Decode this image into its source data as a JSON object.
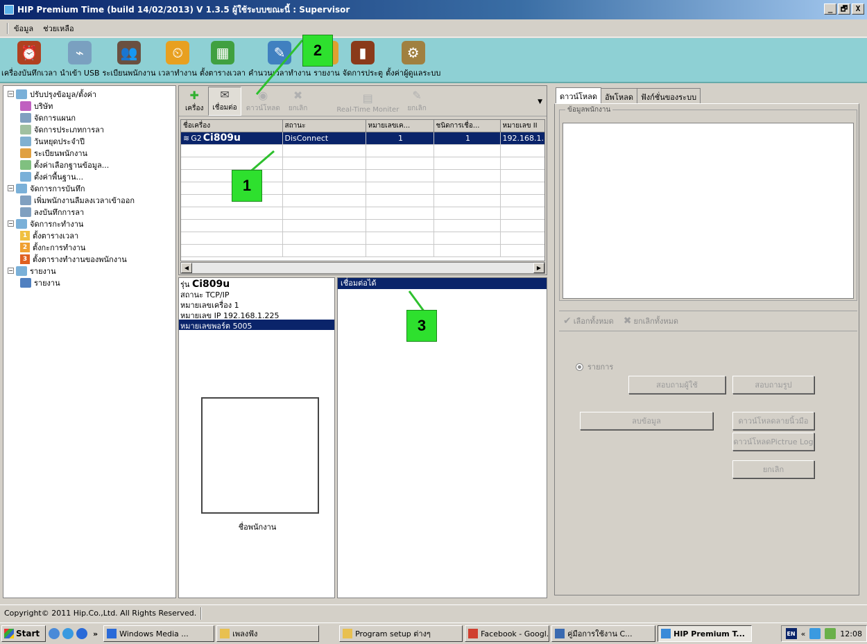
{
  "window": {
    "title": "HIP Premium Time (build 14/02/2013) V 1.3.5   ผู้ใช้ระบบขณะนี้ : Supervisor",
    "buttons": [
      "_",
      "🗗",
      "X"
    ]
  },
  "menu": [
    "ข้อมูล",
    "ช่วยเหลือ"
  ],
  "toolbar": [
    {
      "label": "เครื่องบันทึกเวลา",
      "icon": "clock-icon",
      "color": "#b04020"
    },
    {
      "label": "นำเข้า USB",
      "icon": "usb-icon",
      "color": "#7aa0c0"
    },
    {
      "label": "ระเบียนพนักงาน",
      "icon": "employees-icon",
      "color": "#6a5040"
    },
    {
      "label": "เวลาทำงาน",
      "icon": "alarm-icon",
      "color": "#e8a020"
    },
    {
      "label": "ตั้งตารางเวลา",
      "icon": "calendar-icon",
      "color": "#40a040"
    },
    {
      "label": "คำนวนเวลาทำงาน",
      "icon": "calculate-icon",
      "color": "#4080c0"
    },
    {
      "label": "รายงาน",
      "icon": "report-icon",
      "color": "#e0a030"
    },
    {
      "label": "จัดการประตู",
      "icon": "door-icon",
      "color": "#8a3a1a"
    },
    {
      "label": "ตั้งค่าผู้ดูแลระบบ",
      "icon": "admin-settings-icon",
      "color": "#a08040"
    }
  ],
  "tree": [
    {
      "level": 0,
      "label": "ปรับปรุงข้อมูล/ตั้งค่า",
      "expander": "−",
      "color": "#7ab0d8"
    },
    {
      "level": 1,
      "label": "บริษัท",
      "color": "#c060c0"
    },
    {
      "level": 1,
      "label": "จัดการแผนก",
      "color": "#80a0c0"
    },
    {
      "level": 1,
      "label": "จัดการประเภทการลา",
      "color": "#a0c0a0"
    },
    {
      "level": 1,
      "label": "วันหยุดประจำปี",
      "color": "#80b0d0"
    },
    {
      "level": 1,
      "label": "ระเบียนพนักงาน",
      "color": "#e0a040"
    },
    {
      "level": 1,
      "label": "ตั้งค่าเลือกฐานข้อมูล...",
      "color": "#80c080"
    },
    {
      "level": 1,
      "label": "ตั้งค่าพื้นฐาน...",
      "color": "#7ab0d8"
    },
    {
      "level": 0,
      "label": "จัดการการบันทึก",
      "expander": "−",
      "color": "#7ab0d8"
    },
    {
      "level": 1,
      "label": "เพิ่มพนักงานลืมลงเวลาเข้าออก",
      "color": "#80a0c0"
    },
    {
      "level": 1,
      "label": "ลงบันทึกการลา",
      "color": "#80a0c0"
    },
    {
      "level": 0,
      "label": "จัดการกะทำงาน",
      "expander": "−",
      "color": "#7ab0d8"
    },
    {
      "level": 1,
      "label": "ตั้งตารางเวลา",
      "num": "1",
      "color": "#f0c040"
    },
    {
      "level": 1,
      "label": "ตั้งกะการทำงาน",
      "num": "2",
      "color": "#f0a030"
    },
    {
      "level": 1,
      "label": "ตั้งตารางทำงานของพนักงาน",
      "num": "3",
      "color": "#e06020"
    },
    {
      "level": 0,
      "label": "รายงาน",
      "expander": "−",
      "color": "#7ab0d8"
    },
    {
      "level": 1,
      "label": "รายงาน",
      "color": "#5080c0"
    }
  ],
  "device_toolbar": [
    {
      "label": "เครื่อง",
      "icon": "plus-icon",
      "glyph": "✚",
      "enabled": true,
      "pressed": false
    },
    {
      "label": "เชื่อมต่อ",
      "icon": "connect-icon",
      "glyph": "✉",
      "enabled": true,
      "pressed": true
    },
    {
      "label": "ดาวน์โหลด",
      "icon": "download-icon",
      "glyph": "◉",
      "enabled": false,
      "pressed": false
    },
    {
      "label": "ยกเลิก",
      "icon": "cancel-icon",
      "glyph": "✖",
      "enabled": false,
      "pressed": false
    },
    {
      "label": "Real-Time Moniter",
      "icon": "monitor-icon",
      "glyph": "▤",
      "enabled": false,
      "pressed": false
    },
    {
      "label": "ยกเลิก",
      "icon": "cancel-monitor-icon",
      "glyph": "✎",
      "enabled": false,
      "pressed": false
    }
  ],
  "device_table": {
    "columns": [
      "ชื่อเครื่อง",
      "สถานะ",
      "หมายเลขเค...",
      "ชนิดการเชื่อ...",
      "หมายเลข II"
    ],
    "rows": [
      {
        "name_prefix": "G2",
        "name": "Ci809u",
        "status": "DisConnect",
        "machine_no": "1",
        "conn_type": "1",
        "ip": "192.168.1."
      }
    ]
  },
  "device_info": {
    "model_label": "รุ่น",
    "model": "Ci809u",
    "rows": [
      {
        "label": "สถานะ",
        "value": "TCP/IP"
      },
      {
        "label": "หมายเลขเครื่อง",
        "value": "1"
      },
      {
        "label": "หมายเลข IP",
        "value": "192.168.1.225"
      },
      {
        "label": "หมายเลขพอร์ต",
        "value": "5005"
      }
    ],
    "photo_label": "ชื่อพนักงาน"
  },
  "log": {
    "header": "เชื่อมต่อได้"
  },
  "right_panel": {
    "tabs": [
      "ดาวน์โหลด",
      "อัพโหลด",
      "ฟังก์ชั่นของระบบ"
    ],
    "group_label": "ข้อมูลพนักงาน",
    "select_all": "เลือกทั้งหมด",
    "deselect_all": "ยกเลิกทั้งหมด",
    "radio_label": "รายการ",
    "buttons": {
      "query_user": "สอบถามผู้ใช้",
      "query_photo": "สอบถามรูป",
      "delete_data": "ลบข้อมูล",
      "download_fingerprint": "ดาวน์โหลดลายนิ้วมือ",
      "download_picture_log": "ดาวน์โหลดPictrue Log",
      "cancel": "ยกเลิก"
    }
  },
  "status": {
    "copyright": "Copyright© 2011 Hip.Co.,Ltd. All Rights Reserved."
  },
  "taskbar": {
    "start": "Start",
    "chevron": "»",
    "items": [
      {
        "label": "Windows Media ...",
        "color": "#2a6ad8"
      },
      {
        "label": "เพลงฟัง",
        "color": "#e8c050"
      },
      {
        "label": "Program setup ต่างๆ",
        "color": "#e8c050"
      },
      {
        "label": "Facebook - Googl...",
        "color": "#d04030"
      },
      {
        "label": "คู่มือการใช้งาน C...",
        "color": "#3a6ab0"
      },
      {
        "label": "HIP Premium T...",
        "color": "#3a8ad8",
        "active": true
      }
    ],
    "lang": "EN",
    "tray_chevron": "«",
    "clock": "12:08"
  },
  "callouts": [
    "1",
    "2",
    "3"
  ]
}
